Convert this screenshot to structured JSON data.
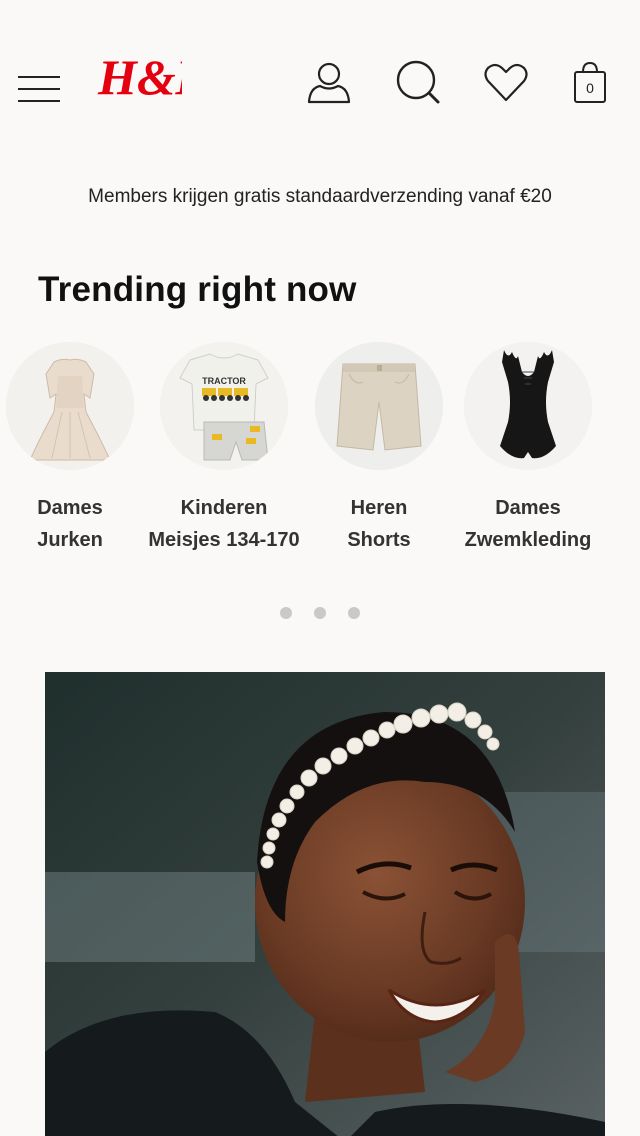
{
  "header": {
    "logo_text": "H&M",
    "brand_color": "#e50010",
    "icons": [
      "menu-icon",
      "account-icon",
      "search-icon",
      "favorites-icon",
      "bag-icon"
    ],
    "bag_count": "0"
  },
  "promo": {
    "text": "Members krijgen gratis standaardverzending vanaf €20"
  },
  "trending": {
    "title": "Trending right now",
    "items": [
      {
        "line1": "Dames",
        "line2": "Jurken"
      },
      {
        "line1": "Kinderen",
        "line2": "Meisjes 134-170"
      },
      {
        "line1": "Heren",
        "line2": "Shorts"
      },
      {
        "line1": "Dames",
        "line2": "Zwemkleding"
      }
    ],
    "tshirt_print": "TRACTOR",
    "pagination": {
      "pages": 3,
      "active": 0
    }
  },
  "hero": {
    "image": "woman-with-pearl-headband"
  }
}
